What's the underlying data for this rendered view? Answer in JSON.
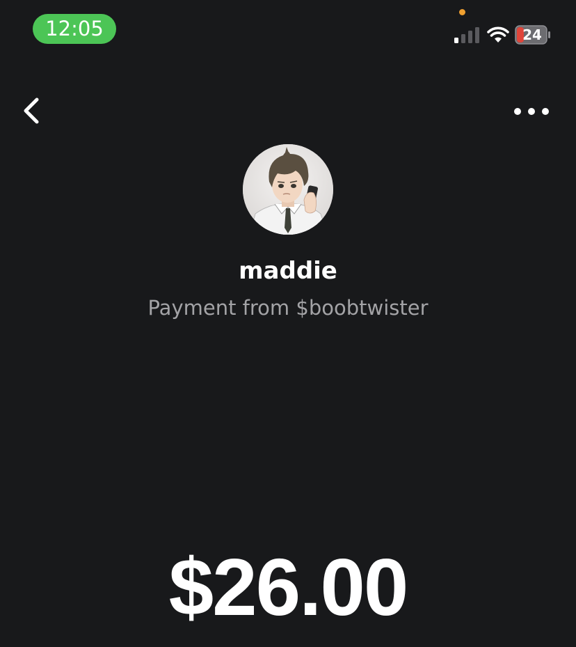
{
  "status_bar": {
    "time": "12:05",
    "battery_level": "24",
    "signal_icon": "cellular-signal-icon",
    "wifi_icon": "wifi-icon",
    "battery_icon": "battery-charging-icon",
    "time_pill_color": "#4cc556",
    "privacy_dot_color": "#f0a030"
  },
  "nav": {
    "back_icon": "chevron-left-icon",
    "more_icon": "more-horizontal-icon"
  },
  "profile": {
    "name": "maddie",
    "subtitle": "Payment from $boobtwister"
  },
  "payment": {
    "amount": "$26.00"
  },
  "theme": {
    "background": "#18191b",
    "text_primary": "#ffffff",
    "text_secondary": "#a3a3a6"
  }
}
